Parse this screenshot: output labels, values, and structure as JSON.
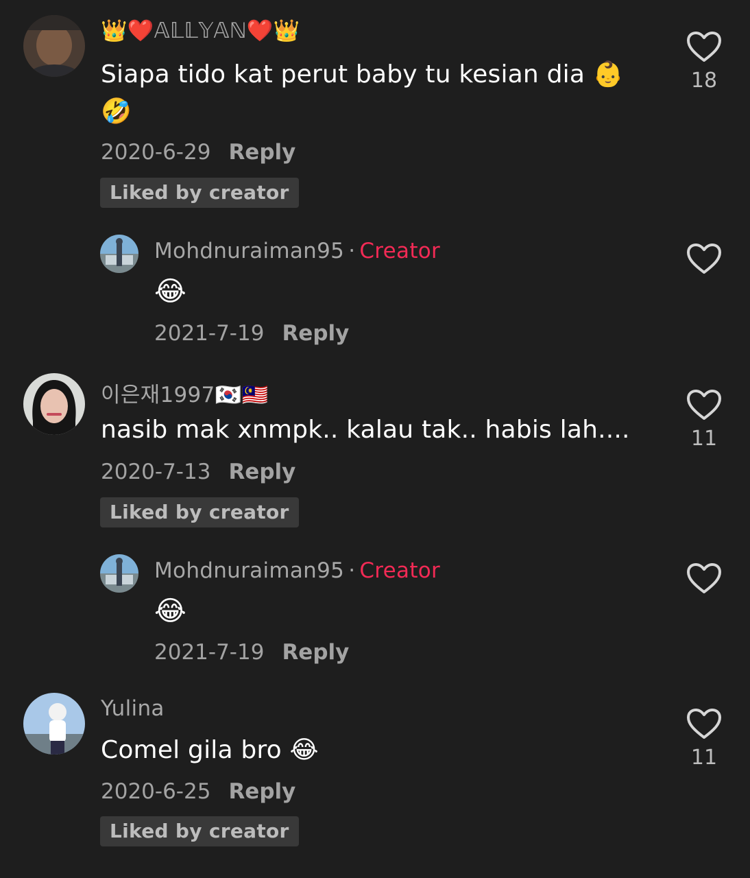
{
  "comments": [
    {
      "username": "👑❤️𝔸𝕃𝕃𝕐𝔸ℕ❤️👑",
      "text_line1": "Siapa tido kat perut baby tu kesian dia 👶",
      "text_line2": "🤣",
      "date": "2020-6-29",
      "reply_label": "Reply",
      "liked_label": "Liked by creator",
      "likes": "18"
    },
    {
      "username": "Mohdnuraiman95",
      "separator": "·",
      "badge": "Creator",
      "text": "😂",
      "date": "2021-7-19",
      "reply_label": "Reply"
    },
    {
      "username": "이은재1997🇰🇷🇲🇾",
      "text": "nasib mak xnmpk.. kalau tak.. habis lah....",
      "date": "2020-7-13",
      "reply_label": "Reply",
      "liked_label": "Liked by creator",
      "likes": "11"
    },
    {
      "username": "Mohdnuraiman95",
      "separator": "·",
      "badge": "Creator",
      "text": "😂",
      "date": "2021-7-19",
      "reply_label": "Reply"
    },
    {
      "username": "Yulina",
      "text": "Comel gila bro 😂",
      "date": "2020-6-25",
      "reply_label": "Reply",
      "liked_label": "Liked by creator",
      "likes": "11"
    }
  ],
  "icons": {
    "like": "heart-outline-icon"
  },
  "colors": {
    "background": "#1e1e1e",
    "creator_badge": "#f22a55",
    "secondary_text": "#a8a8a8"
  }
}
